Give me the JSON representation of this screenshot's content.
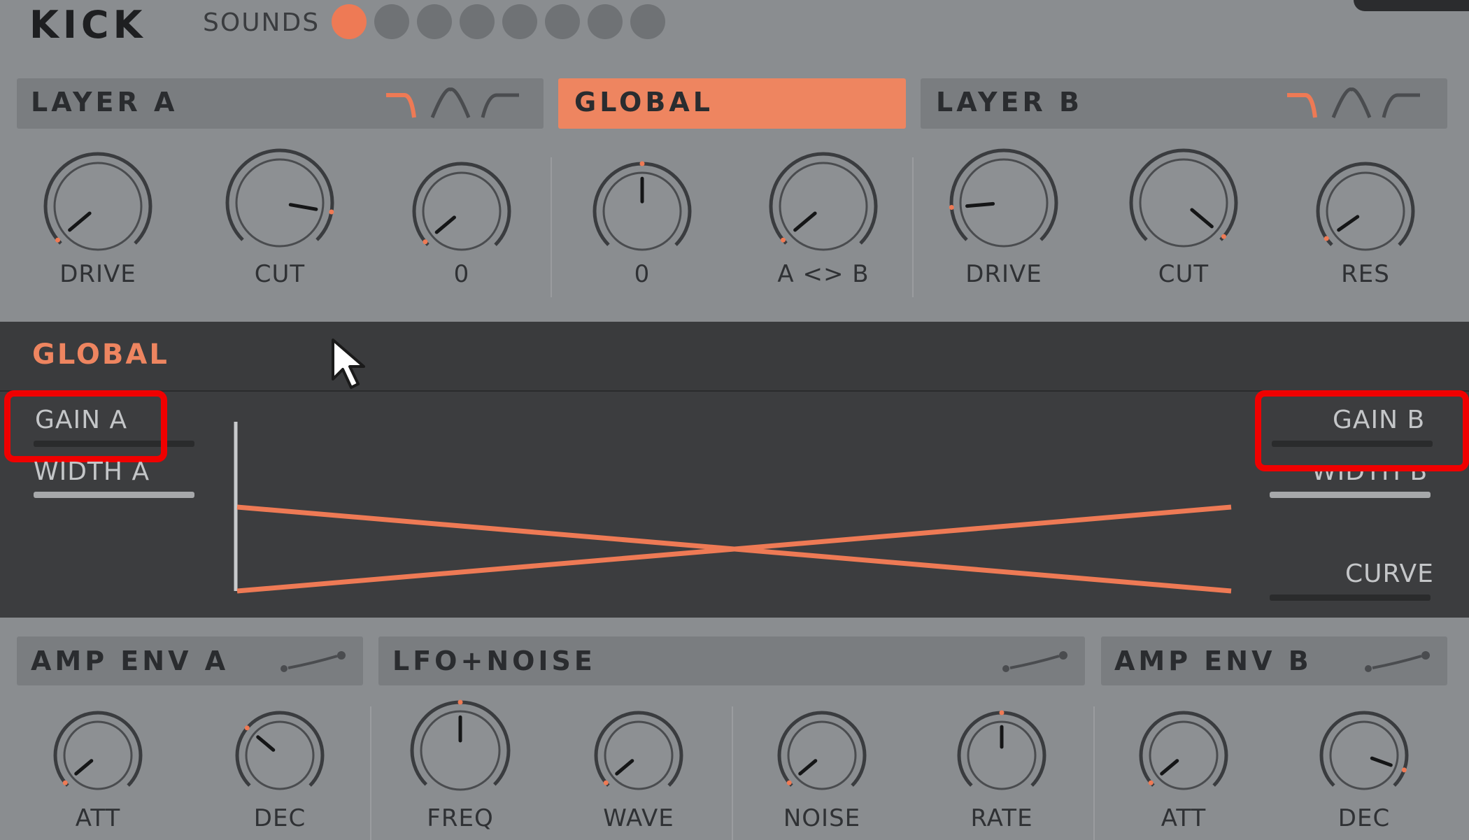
{
  "header": {
    "title": "KICK",
    "sounds_label": "SOUNDS",
    "sound_slots": 8,
    "active_slot": 1
  },
  "sections": {
    "layer_a": {
      "label": "LAYER A",
      "filters": [
        "lowpass-icon",
        "bandpass-icon",
        "highpass-icon"
      ]
    },
    "global": {
      "label": "GLOBAL"
    },
    "layer_b": {
      "label": "LAYER B",
      "filters": [
        "lowpass-icon",
        "bandpass-icon",
        "highpass-icon"
      ]
    }
  },
  "knobs_top": [
    {
      "label": "DRIVE",
      "angle": -130
    },
    {
      "label": "CUT",
      "angle": 100
    },
    {
      "label": "0",
      "angle": -130
    },
    {
      "label": "0",
      "angle": 0
    },
    {
      "label": "A <> B",
      "angle": -130
    },
    {
      "label": "DRIVE",
      "angle": -95
    },
    {
      "label": "CUT",
      "angle": 130
    },
    {
      "label": "RES",
      "angle": -125
    }
  ],
  "global_panel": {
    "label": "GLOBAL",
    "gain_a": "GAIN A",
    "width_a": "WIDTH A",
    "gain_b": "GAIN B",
    "width_b": "WIDTH B",
    "curve": "CURVE"
  },
  "envelopes": {
    "amp_env_a": "AMP ENV A",
    "lfo_noise": "LFO+NOISE",
    "amp_env_b": "AMP ENV B"
  },
  "knobs_bottom": [
    {
      "label": "ATT",
      "angle": -130
    },
    {
      "label": "DEC",
      "angle": -50
    },
    {
      "label": "FREQ",
      "angle": 0
    },
    {
      "label": "WAVE",
      "angle": -130
    },
    {
      "label": "NOISE",
      "angle": -130
    },
    {
      "label": "RATE",
      "angle": 0
    },
    {
      "label": "ATT",
      "angle": -130
    },
    {
      "label": "DEC",
      "angle": 110
    }
  ],
  "colors": {
    "accent": "#ee8560",
    "panel": "#8a8d90",
    "dark_panel": "#3c3d3f",
    "highlight": "#f00000"
  }
}
